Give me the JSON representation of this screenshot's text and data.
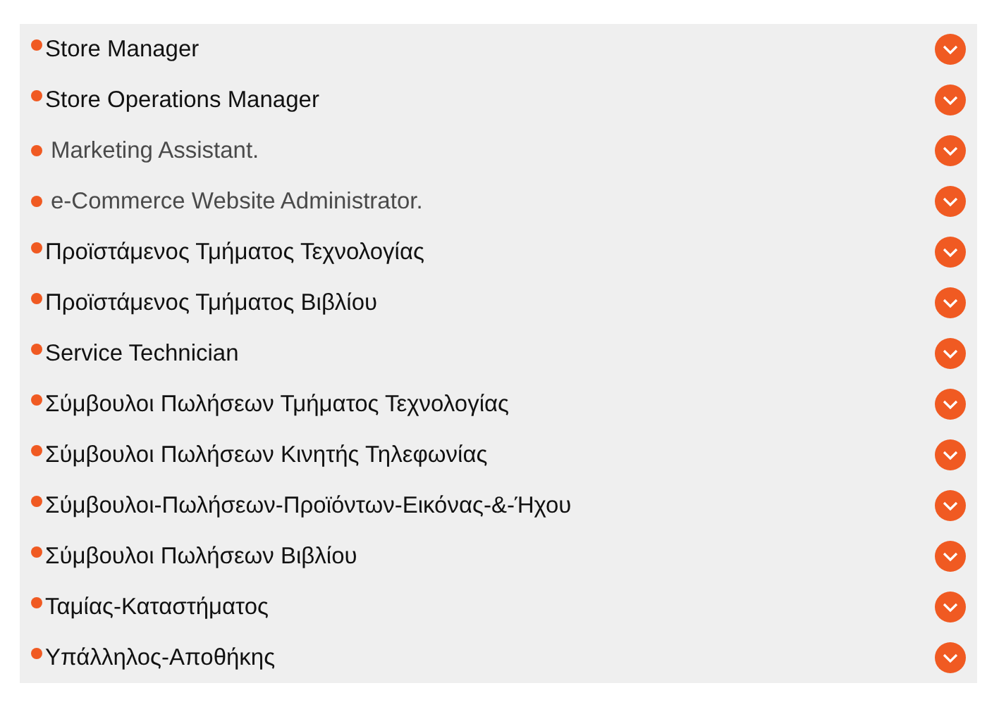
{
  "items": [
    {
      "label": "Store Manager",
      "kind": "tight"
    },
    {
      "label": "Store Operations Manager",
      "kind": "tight"
    },
    {
      "label": "Marketing Assistant.",
      "kind": "spaced"
    },
    {
      "label": "e-Commerce Website Administrator.",
      "kind": "spaced"
    },
    {
      "label": "Προϊστάμενος Τμήματος Τεχνολογίας",
      "kind": "tight"
    },
    {
      "label": "Προϊστάμενος Τμήματος Βιβλίου",
      "kind": "tight"
    },
    {
      "label": "Service Technician",
      "kind": "tight"
    },
    {
      "label": "Σύμβουλοι Πωλήσεων Τμήματος Τεχνολογίας",
      "kind": "tight"
    },
    {
      "label": "Σύμβουλοι Πωλήσεων Κινητής Τηλεφωνίας",
      "kind": "tight"
    },
    {
      "label": "Σύμβουλοι-Πωλήσεων-Προϊόντων-Εικόνας-&-Ήχου",
      "kind": "tight"
    },
    {
      "label": "Σύμβουλοι Πωλήσεων Βιβλίου",
      "kind": "tight"
    },
    {
      "label": "Ταμίας-Καταστήματος",
      "kind": "tight"
    },
    {
      "label": "Υπάλληλος-Αποθήκης",
      "kind": "tight"
    }
  ]
}
